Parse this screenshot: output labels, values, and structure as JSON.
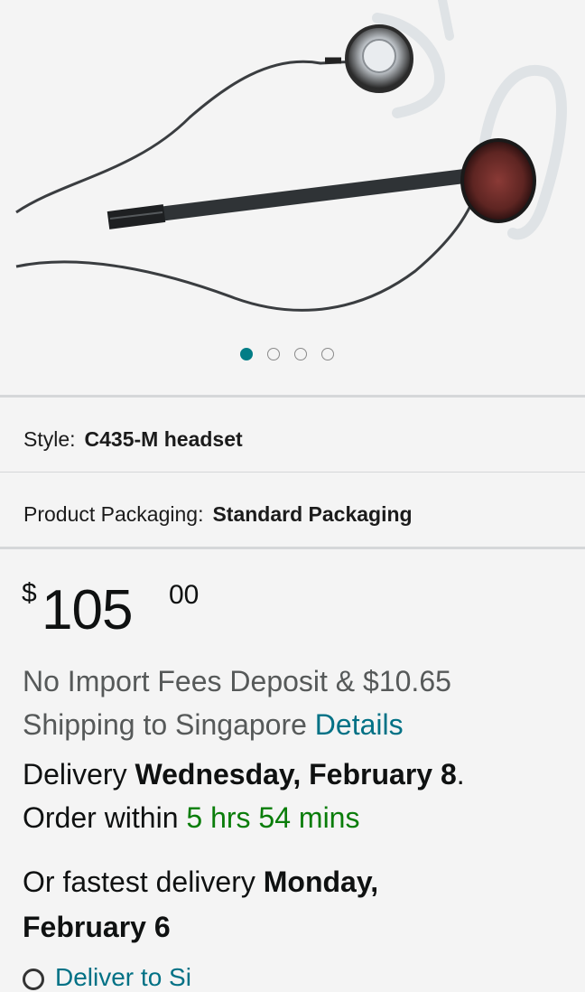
{
  "carousel": {
    "count": 4,
    "active_index": 0
  },
  "options": {
    "style": {
      "label": "Style:",
      "value": "C435-M headset"
    },
    "packaging": {
      "label": "Product Packaging:",
      "value": "Standard Packaging"
    }
  },
  "price": {
    "symbol": "$",
    "whole": "105",
    "fraction": "00"
  },
  "shipping": {
    "text_line1": "No Import Fees Deposit & $10.65",
    "text_line2": "Shipping to Singapore",
    "details_link": "Details"
  },
  "delivery": {
    "prefix": "Delivery",
    "date": "Wednesday, February 8",
    "suffix": ".",
    "order_within_label": "Order within",
    "countdown": "5 hrs 54 mins"
  },
  "fastest": {
    "prefix": "Or fastest delivery",
    "date_part1": "Monday,",
    "date_part2": "February 6"
  },
  "deliver_to": {
    "label": "Deliver to Si"
  },
  "colors": {
    "accent_teal": "#007185",
    "carousel_active": "#027d86",
    "countdown_green": "#0a7d0a"
  }
}
